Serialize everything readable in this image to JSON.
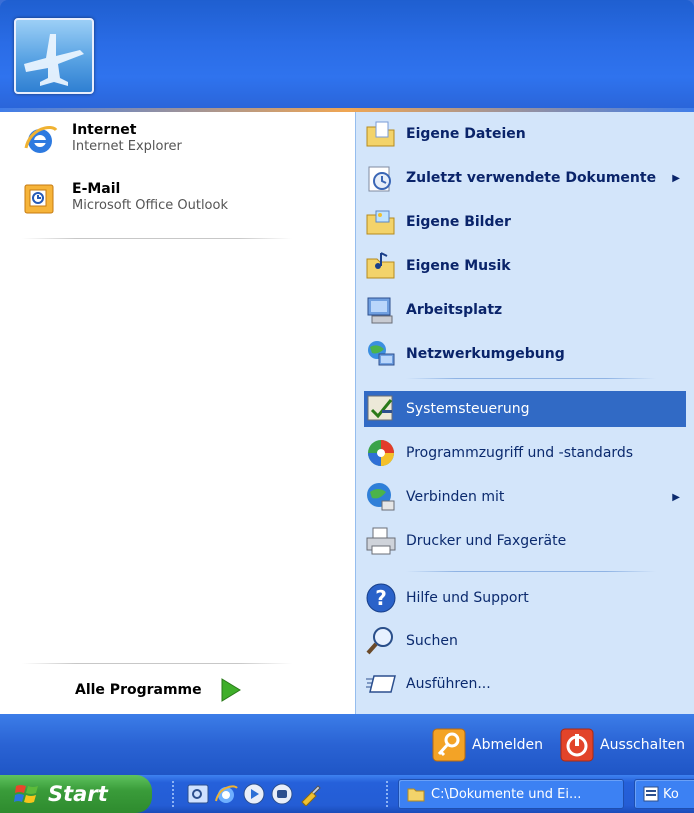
{
  "pinned": [
    {
      "title": "Internet",
      "subtitle": "Internet Explorer",
      "icon": "internet-explorer-icon"
    },
    {
      "title": "E-Mail",
      "subtitle": "Microsoft Office Outlook",
      "icon": "outlook-icon"
    }
  ],
  "all_programs": {
    "label": "Alle Programme",
    "icon": "green-arrow-icon"
  },
  "places": [
    {
      "label": "Eigene Dateien",
      "icon": "folder-documents-icon",
      "bold": true,
      "submenu": false
    },
    {
      "label": "Zuletzt verwendete Dokumente",
      "icon": "recent-documents-icon",
      "bold": true,
      "submenu": true
    },
    {
      "label": "Eigene Bilder",
      "icon": "folder-pictures-icon",
      "bold": true,
      "submenu": false
    },
    {
      "label": "Eigene Musik",
      "icon": "folder-music-icon",
      "bold": true,
      "submenu": false
    },
    {
      "label": "Arbeitsplatz",
      "icon": "computer-icon",
      "bold": true,
      "submenu": false
    },
    {
      "label": "Netzwerkumgebung",
      "icon": "network-icon",
      "bold": true,
      "submenu": false
    }
  ],
  "system": [
    {
      "label": "Systemsteuerung",
      "icon": "control-panel-icon",
      "selected": true,
      "submenu": false
    },
    {
      "label": "Programmzugriff und -standards",
      "icon": "program-access-icon",
      "selected": false,
      "submenu": false
    },
    {
      "label": "Verbinden mit",
      "icon": "connect-icon",
      "selected": false,
      "submenu": true
    },
    {
      "label": "Drucker und Faxgeräte",
      "icon": "printer-icon",
      "selected": false,
      "submenu": false
    }
  ],
  "help": [
    {
      "label": "Hilfe und Support",
      "icon": "help-icon"
    },
    {
      "label": "Suchen",
      "icon": "search-icon"
    },
    {
      "label": "Ausführen...",
      "icon": "run-icon"
    }
  ],
  "submenu_arrow": "▶",
  "footer": {
    "logoff": "Abmelden",
    "shutdown": "Ausschalten"
  },
  "taskbar": {
    "start": "Start",
    "window1": "C:\\Dokumente und Ei...",
    "window2": "Ko"
  },
  "colors": {
    "selection": "#316ac5",
    "start_green": "#3a9c3a",
    "taskbar_blue": "#245dd5"
  }
}
